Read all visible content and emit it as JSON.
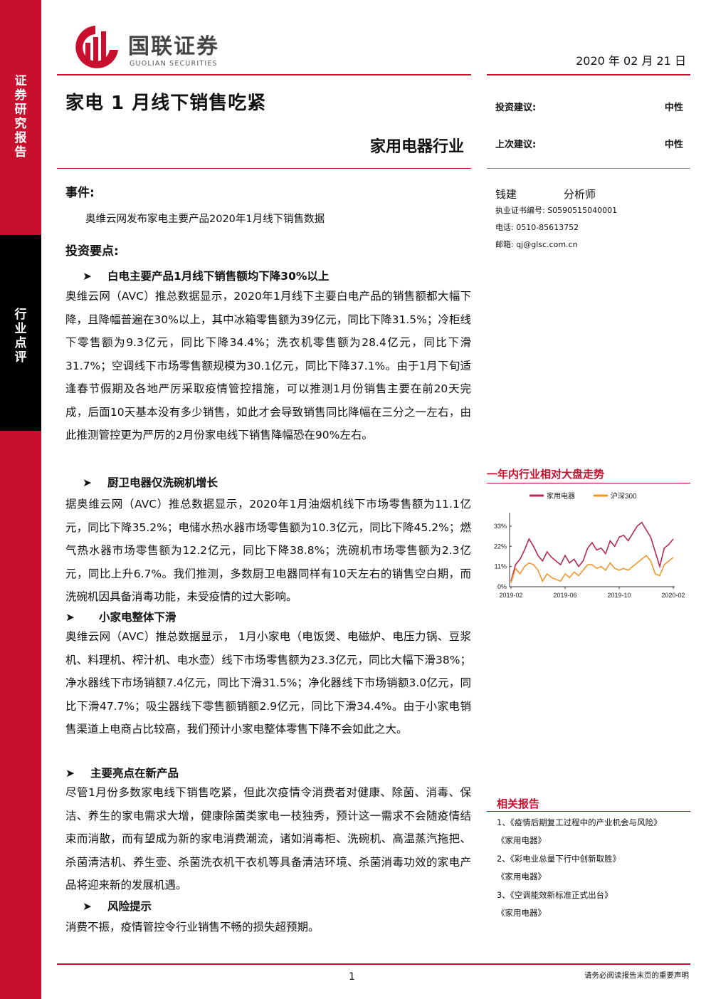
{
  "side": {
    "top_label": "证券研究报告",
    "mid_label": "行业点评"
  },
  "header": {
    "logo_cn": "国联证券",
    "logo_en": "GUOLIAN SECURITIES",
    "date": "2020 年 02 月 21 日"
  },
  "report": {
    "title": "家电 1 月线下销售吃紧",
    "industry": "家用电器行业"
  },
  "rating": {
    "current_label": "投资建议:",
    "current_value": "中性",
    "previous_label": "上次建议:",
    "previous_value": "中性"
  },
  "analyst": {
    "name": "钱建",
    "role": "分析师",
    "license": "执业证书编号: S0590515040001",
    "phone": "电话: 0510-85613752",
    "email": "邮箱: qj@glsc.com.cn"
  },
  "event": {
    "heading": "事件:",
    "text": "奥维云网发布家电主要产品2020年1月线下销售数据"
  },
  "points_heading": "投资要点:",
  "sections": [
    {
      "heading": "白电主要产品1月线下销售额均下降30%以上",
      "body": "奥维云网（AVC）推总数据显示，2020年1月线下主要白电产品的销售额都大幅下降，且降幅普遍在30%以上，其中冰箱零售额为39亿元，同比下降31.5%；冷柜线下零售额为9.3亿元，同比下降34.4%；洗衣机零售额为28.4亿元，同比下滑31.7%；空调线下市场零售额规模为30.1亿元，同比下降37.1%。由于1月下旬适逢春节假期及各地严厉采取疫情管控措施，可以推测1月份销售主要在前20天完成，后面10天基本没有多少销售，如此才会导致销售同比降幅在三分之一左右，由此推测管控更为严厉的2月份家电线下销售降幅恐在90%左右。"
    },
    {
      "heading": "厨卫电器仅洗碗机增长",
      "body": "据奥维云网（AVC）推总数据显示，2020年1月油烟机线下市场零售额为11.1亿元，同比下降35.2%；电储水热水器市场零售额为10.3亿元，同比下降45.2%；燃气热水器市场零售额为12.2亿元，同比下降38.8%；洗碗机市场零售额为2.3亿元，同比上升6.7%。我们推测，多数厨卫电器同样有10天左右的销售空白期，而洗碗机因具备消毒功能，未受疫情的过大影响。"
    },
    {
      "heading": "小家电整体下滑",
      "body": "奥维云网（AVC）推总数据显示， 1月小家电（电饭煲、电磁炉、电压力锅、豆浆机、料理机、榨汁机、电水壶）线下市场零售额为23.3亿元，同比大幅下滑38%；净水器线下市场销额7.4亿元，同比下滑31.5%；净化器线下市场销额3.0亿元，同比下滑47.7%；吸尘器线下零售额销额2.9亿元，同比下滑34.4%。由于小家电销售渠道上电商占比较高，我们预计小家电整体零售下降不会如此之大。"
    },
    {
      "heading": "主要亮点在新产品",
      "body": "尽管1月份多数家电线下销售吃紧，但此次疫情令消费者对健康、除菌、消毒、保洁、养生的家电需求大增，健康除菌类家电一枝独秀，预计这一需求不会随疫情结束而消散，而有望成为新的家电消费潮流，诸如消毒柜、洗碗机、高温蒸汽拖把、杀菌清洁机、养生壶、杀菌洗衣机干衣机等具备清洁环境、杀菌消毒功效的家电产品将迎来新的发展机遇。"
    },
    {
      "heading": "风险提示",
      "body": "消费不振，疫情管控令行业销售不畅的损失超预期。"
    }
  ],
  "chart_title": "一年内行业相对大盘走势",
  "chart_data": {
    "type": "line",
    "title": "一年内行业相对大盘走势",
    "x_ticks": [
      "2019-02",
      "2019-06",
      "2019-10",
      "2020-02"
    ],
    "y_ticks": [
      "0%",
      "11%",
      "22%",
      "33%"
    ],
    "ylim": [
      0,
      38
    ],
    "series": [
      {
        "name": "家用电器",
        "color": "#b5275a",
        "values": [
          3,
          12,
          15,
          20,
          26,
          22,
          17,
          14,
          19,
          16,
          14,
          12,
          17,
          13,
          15,
          11,
          14,
          21,
          24,
          20,
          21,
          18,
          25,
          22,
          27,
          28,
          25,
          29,
          33,
          35,
          31,
          27,
          19,
          11,
          21,
          23,
          26
        ]
      },
      {
        "name": "沪深300",
        "color": "#f0962a",
        "values": [
          2,
          10,
          7,
          11,
          13,
          12,
          9,
          3,
          7,
          5,
          4,
          3,
          7,
          5,
          8,
          6,
          9,
          12,
          12,
          10,
          11,
          9,
          13,
          10,
          9,
          10,
          9,
          11,
          13,
          15,
          17,
          14,
          7,
          6,
          12,
          14,
          16
        ]
      }
    ],
    "legend_position": "top"
  },
  "related": {
    "heading": "相关报告",
    "items": [
      "1、《疫情后期复工过程中的产业机会与风险》",
      "《家用电器》",
      "2、《彩电业总量下行中创新取胜》",
      "《家用电器》",
      "3、《空调能效新标准正式出台》",
      "《家用电器》"
    ]
  },
  "footer": {
    "page": "1",
    "disclaimer": "请务必阅读报告末页的重要声明"
  },
  "colors": {
    "brand_red": "#c8102e",
    "series_appliance": "#b5275a",
    "series_hs300": "#f0962a"
  }
}
